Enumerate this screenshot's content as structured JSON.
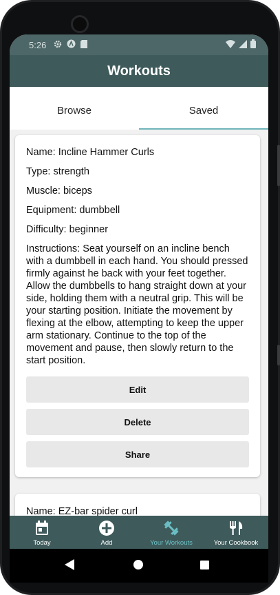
{
  "status": {
    "time": "5:26"
  },
  "app": {
    "title": "Workouts"
  },
  "tabs": [
    {
      "label": "Browse"
    },
    {
      "label": "Saved"
    }
  ],
  "workout": {
    "name": "Name: Incline Hammer Curls",
    "type": "Type: strength",
    "muscle": "Muscle: biceps",
    "equipment": "Equipment: dumbbell",
    "difficulty": "Difficulty: beginner",
    "instructions": "Instructions: Seat yourself on an incline bench with a dumbbell in each hand. You should pressed firmly against he back with your feet together. Allow the dumbbells to hang straight down at your side, holding them with a neutral grip. This will be your starting position. Initiate the movement by flexing at the elbow, attempting to keep the upper arm stationary. Continue to the top of the movement and pause, then slowly return to the start position.",
    "edit_label": "Edit",
    "delete_label": "Delete",
    "share_label": "Share"
  },
  "next_workout": {
    "name": "Name: EZ-bar spider curl"
  },
  "bottom_nav": [
    {
      "label": "Today",
      "icon": "calendar-icon"
    },
    {
      "label": "Add",
      "icon": "add-circle-icon"
    },
    {
      "label": "Your Workouts",
      "icon": "dumbbell-icon"
    },
    {
      "label": "Your Cookbook",
      "icon": "utensils-icon"
    }
  ],
  "colors": {
    "appbar": "#3e5a5b",
    "statusbar": "#4d6667",
    "accent": "#6bc0c5",
    "button_bg": "#e8e8e8"
  }
}
